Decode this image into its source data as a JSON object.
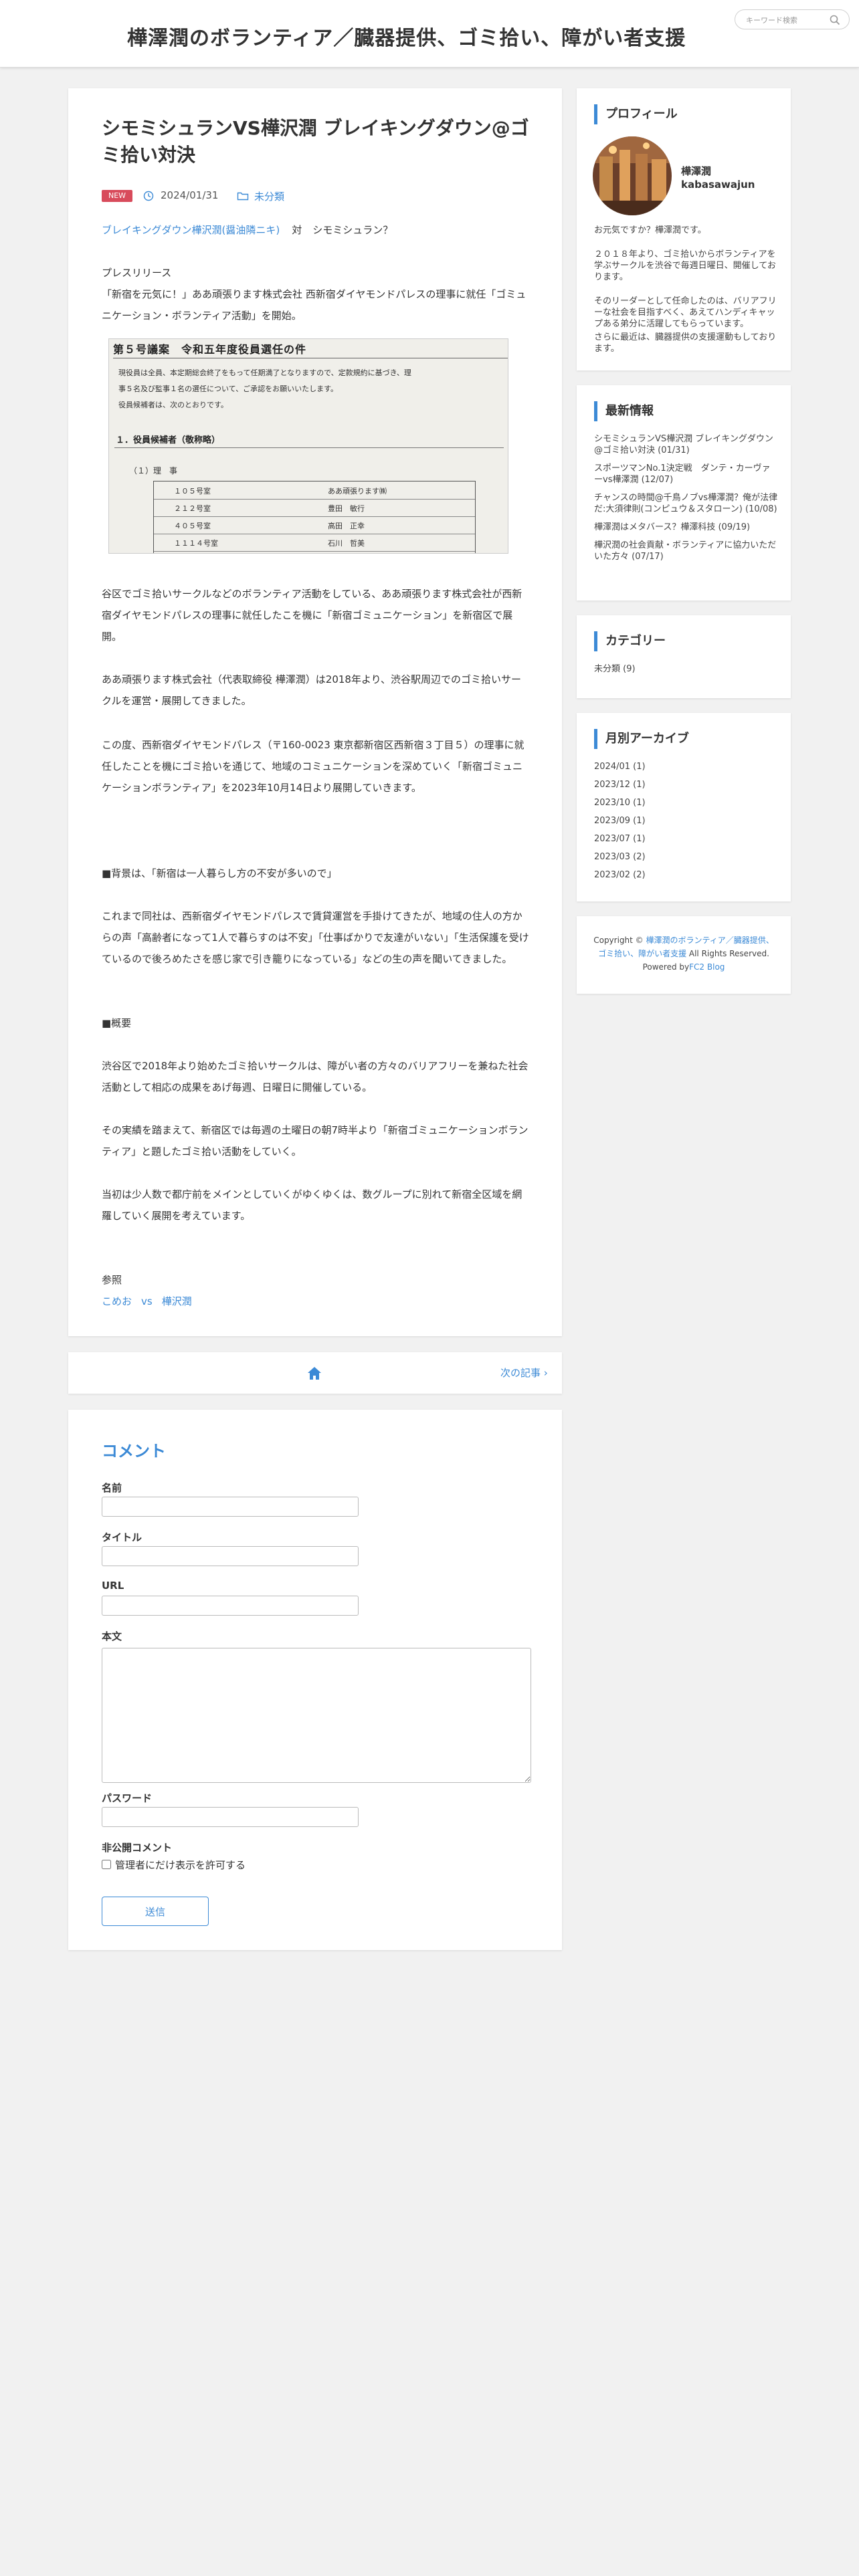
{
  "site": {
    "title": "樺澤潤のボランティア／臓器提供、ゴミ拾い、障がい者支援",
    "search_placeholder": "キーワード検索"
  },
  "article": {
    "title": "シモミシュランVS樺沢潤 ブレイキングダウン@ゴミ拾い対決",
    "badge": "NEW",
    "date": "2024/01/31",
    "category": "未分類",
    "tagline_link": "ブレイキングダウン樺沢潤(醤油隣ニキ)",
    "tagline_vs": "対",
    "tagline_opponent": "シモミシュラン？",
    "paragraphs": [
      "プレスリリース\n「新宿を元気に！」ああ頑張ります株式会社 西新宿ダイヤモンドパレスの理事に就任「ゴミュニケーション・ボランティア活動」を開始。",
      "谷区でゴミ拾いサークルなどのボランティア活動をしている、ああ頑張ります株式会社が西新宿ダイヤモンドパレスの理事に就任したこを機に「新宿ゴミュニケーション」を新宿区で展開。",
      "ああ頑張ります株式会社（代表取締役 樺澤潤）は2018年より、渋谷駅周辺でのゴミ拾いサークルを運営・展開してきました。",
      "この度、西新宿ダイヤモンドパレス（〒160-0023 東京都新宿区西新宿３丁目５）の理事に就任したことを機にゴミ拾いを通じて、地域のコミュニケーションを深めていく「新宿ゴミュニケーションボランティア」を2023年10月14日より展開していきます。",
      "■背景は、「新宿は一人暮らし方の不安が多いので」",
      "これまで同社は、西新宿ダイヤモンドパレスで賃貸運営を手掛けてきたが、地域の住人の方からの声「高齢者になって1人で暮らすのは不安」「仕事ばかりで友達がいない」「生活保護を受けているので後ろめたさを感じ家で引き籠りになっている」などの生の声を聞いてきました。",
      "■概要",
      "渋谷区で2018年より始めたゴミ拾いサークルは、障がい者の方々のバリアフリーを兼ねた社会活動として相応の成果をあげ毎週、日曜日に開催している。",
      "その実績を踏まえて、新宿区では毎週の土曜日の朝7時半より「新宿ゴミュニケーションボランティア」と題したゴミ拾い活動をしていく。",
      "当初は少人数で都庁前をメインとしていくがゆくゆくは、数グループに別れて新宿全区域を網羅していく展開を考えています。"
    ],
    "refs_label": "参照",
    "ref_left": "こめお",
    "ref_vs": "vs",
    "ref_right": "樺沢潤",
    "document_image": {
      "heading": "第５号議案　令和五年度役員選任の件",
      "lines": [
        "現役員は全員、本定期総会終了をもって任期満了となりますので、定款規約に基づき、理",
        "事５名及び監事１名の選任について、ご承認をお願いいたします。",
        "役員候補者は、次のとおりです。"
      ],
      "section": "１．役員候補者（敬称略）",
      "sub": "（１）理　事",
      "rows": [
        {
          "room": "１０５号室",
          "name": "ああ頑張ります㈱"
        },
        {
          "room": "２１２号室",
          "name": "豊田　敏行"
        },
        {
          "room": "４０５号室",
          "name": "高田　正幸"
        },
        {
          "room": "１１１４号室",
          "name": "石川　哲美"
        }
      ]
    }
  },
  "pager": {
    "next_label": "次の記事 ›"
  },
  "comment_form": {
    "title": "コメント",
    "name_label": "名前",
    "title_label": "タイトル",
    "url_label": "URL",
    "body_label": "本文",
    "password_label": "パスワード",
    "secret_label": "非公開コメント",
    "secret_checkbox_label": "管理者にだけ表示を許可する",
    "submit_label": "送信"
  },
  "sidebar": {
    "profile": {
      "title": "プロフィール",
      "name": "樺澤潤",
      "handle": "kabasawajun",
      "texts": [
        "お元気ですか？樺澤潤です。",
        "２０１８年より、ゴミ拾いからボランティアを学ぶサークルを渋谷で毎週日曜日、開催しております。",
        "そのリーダーとして任命したのは、バリアフリーな社会を目指すべく、あえてハンディキャップある弟分に活躍してもらっています。",
        "さらに最近は、臓器提供の支援運動もしております。"
      ]
    },
    "recent": {
      "title": "最新情報",
      "items": [
        "シモミシュランVS樺沢潤 ブレイキングダウン@ゴミ拾い対決 (01/31)",
        "スポーツマンNo.1決定戦　ダンテ・カーヴァーvs樺澤潤 (12/07)",
        "チャンスの時間@千鳥ノブvs樺澤潤？俺が法律だ:大須律則(コンピュウ＆スタローン) (10/08)",
        "樺澤潤はメタバース？樺澤科技 (09/19)",
        "樺沢潤の社会貢献・ボランティアに協力いただいた方々 (07/17)"
      ]
    },
    "category": {
      "title": "カテゴリー",
      "items": [
        "未分類 (9)"
      ]
    },
    "archive": {
      "title": "月別アーカイブ",
      "items": [
        "2024/01 (1)",
        "2023/12 (1)",
        "2023/10 (1)",
        "2023/09 (1)",
        "2023/07 (1)",
        "2023/03 (2)",
        "2023/02 (2)"
      ]
    },
    "copyright": {
      "prefix": "Copyright © ",
      "site_link": "樺澤潤のボランティア／臓器提供、ゴミ拾い、障がい者支援",
      "suffix": " All Rights Reserved.",
      "powered_prefix": "Powered by",
      "powered_link": "FC2 Blog"
    }
  },
  "colors": {
    "accent": "#3c8ad6",
    "badge": "#d84b5b",
    "background": "#f1f1f1"
  },
  "icons": [
    "search-icon",
    "clock-icon",
    "folder-icon",
    "home-icon",
    "chevron-right-icon"
  ]
}
